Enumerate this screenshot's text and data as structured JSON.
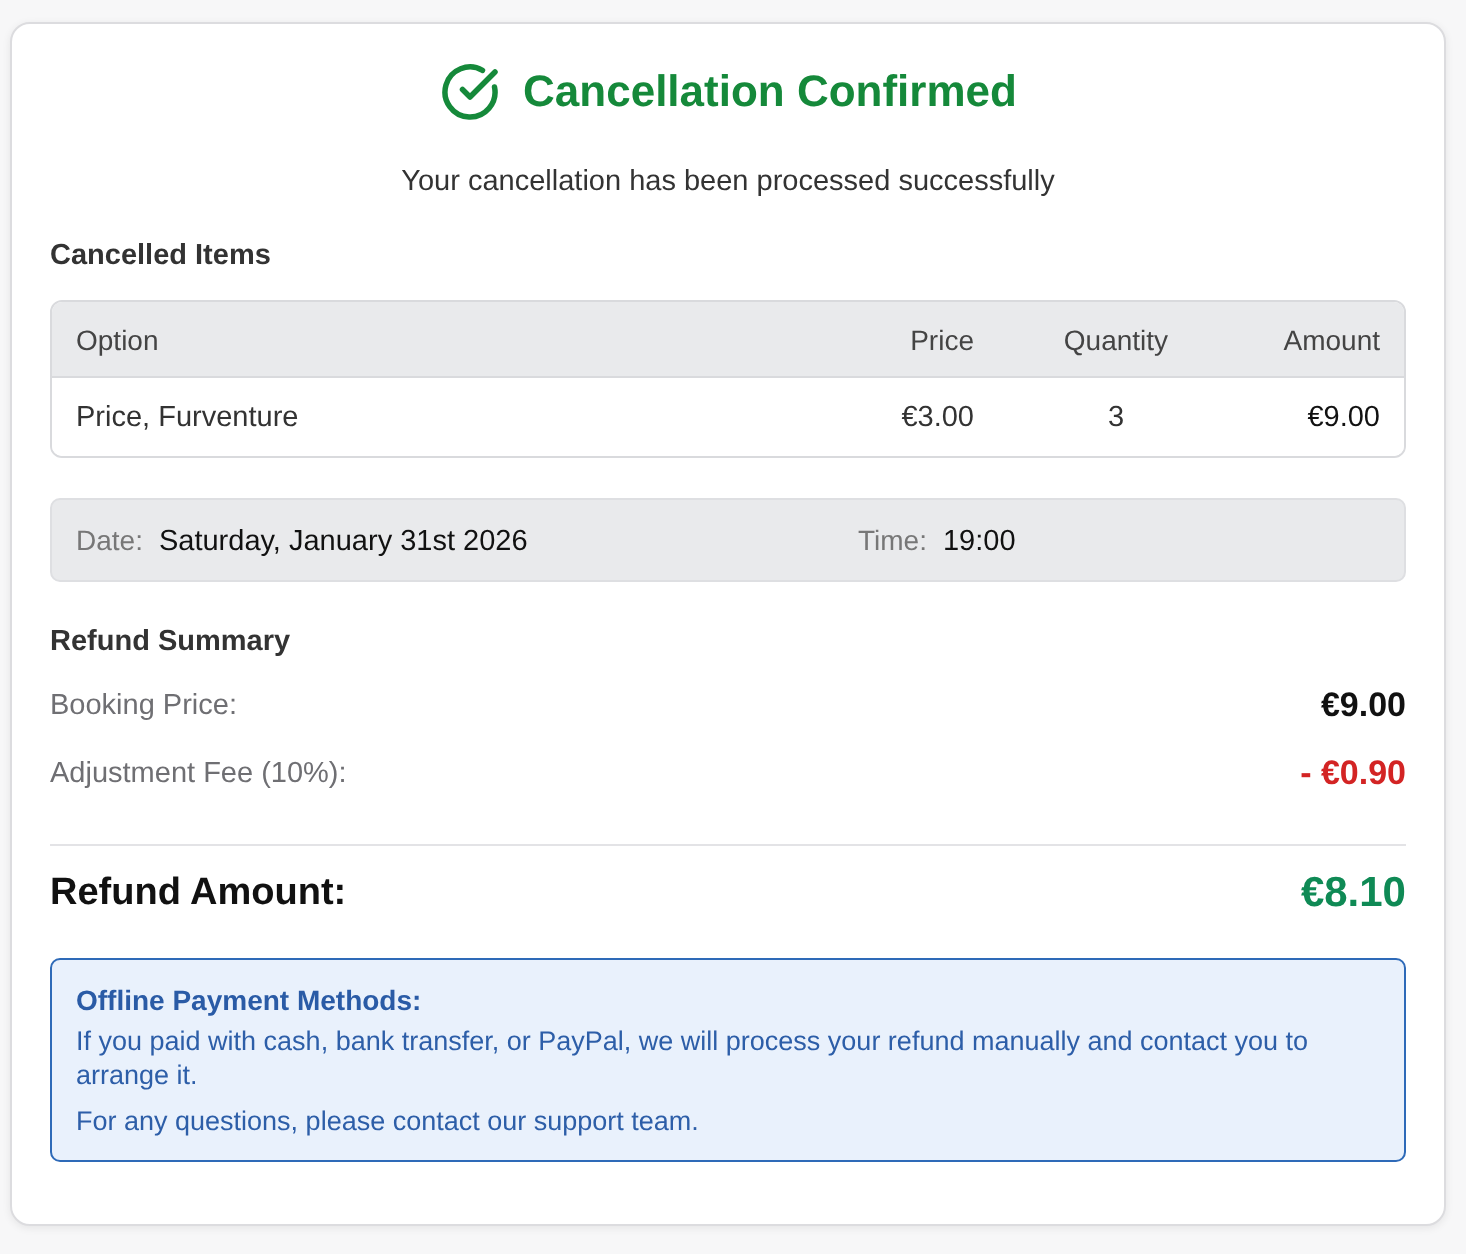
{
  "header": {
    "title": "Cancellation Confirmed",
    "subtitle": "Your cancellation has been processed successfully"
  },
  "cancelled_items": {
    "heading": "Cancelled Items",
    "columns": [
      "Option",
      "Price",
      "Quantity",
      "Amount"
    ],
    "rows": [
      {
        "option": "Price, Furventure",
        "price": "€3.00",
        "quantity": "3",
        "amount": "€9.00"
      }
    ]
  },
  "schedule": {
    "date_label": "Date:",
    "date": "Saturday, January 31st 2026",
    "time_label": "Time:",
    "time": "19:00"
  },
  "refund_summary": {
    "heading": "Refund Summary",
    "lines": [
      {
        "label": "Booking Price:",
        "value": "€9.00",
        "kind": "charge"
      },
      {
        "label": "Adjustment Fee (10%):",
        "value": "- €0.90",
        "kind": "deduction"
      }
    ],
    "total": {
      "label": "Refund Amount:",
      "value": "€8.10"
    }
  },
  "notice": {
    "title": "Offline Payment Methods:",
    "paragraphs": [
      "If you paid with cash, bank transfer, or PayPal, we will process your refund manually and contact you to arrange it.",
      "For any questions, please contact our support team."
    ]
  }
}
